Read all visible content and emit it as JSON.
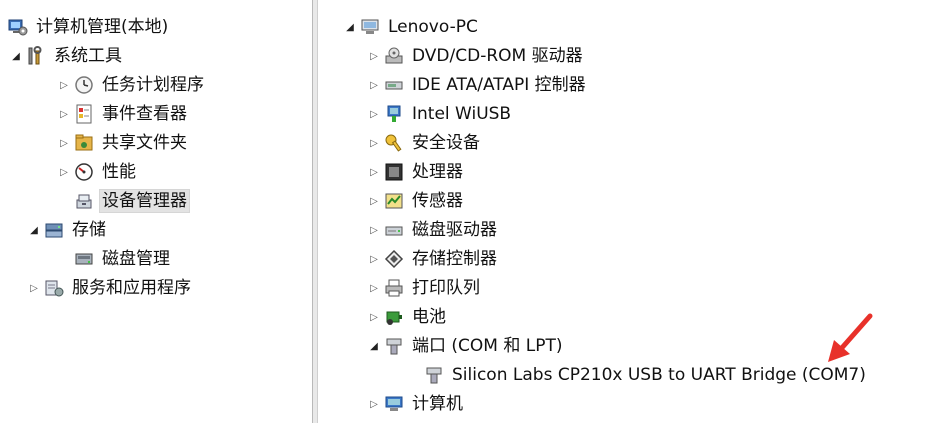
{
  "left_tree": {
    "root": {
      "label": "计算机管理(本地)",
      "icon": "computer-management-icon"
    },
    "system_tools": {
      "label": "系统工具",
      "icon": "tools-icon",
      "expander": "◢"
    },
    "task_scheduler": {
      "label": "任务计划程序",
      "icon": "clock-icon",
      "expander": "▷"
    },
    "event_viewer": {
      "label": "事件查看器",
      "icon": "event-viewer-icon",
      "expander": "▷"
    },
    "shared_folders": {
      "label": "共享文件夹",
      "icon": "shared-folder-icon",
      "expander": "▷"
    },
    "performance": {
      "label": "性能",
      "icon": "performance-icon",
      "expander": "▷"
    },
    "device_manager": {
      "label": "设备管理器",
      "icon": "device-manager-icon",
      "selected": true
    },
    "storage": {
      "label": "存储",
      "icon": "storage-icon",
      "expander": "◢"
    },
    "disk_management": {
      "label": "磁盘管理",
      "icon": "disk-management-icon"
    },
    "services_apps": {
      "label": "服务和应用程序",
      "icon": "services-icon",
      "expander": "▷"
    }
  },
  "right_tree": {
    "root": {
      "label": "Lenovo-PC",
      "icon": "computer-icon",
      "expander": "◢"
    },
    "items": [
      {
        "label": "DVD/CD-ROM 驱动器",
        "icon": "dvd-drive-icon",
        "expander": "▷"
      },
      {
        "label": "IDE ATA/ATAPI 控制器",
        "icon": "ide-controller-icon",
        "expander": "▷"
      },
      {
        "label": "Intel WiUSB",
        "icon": "usb-network-icon",
        "expander": "▷"
      },
      {
        "label": "安全设备",
        "icon": "security-key-icon",
        "expander": "▷"
      },
      {
        "label": "处理器",
        "icon": "processor-icon",
        "expander": "▷"
      },
      {
        "label": "传感器",
        "icon": "sensor-icon",
        "expander": "▷"
      },
      {
        "label": "磁盘驱动器",
        "icon": "disk-drive-icon",
        "expander": "▷"
      },
      {
        "label": "存储控制器",
        "icon": "storage-controller-icon",
        "expander": "▷"
      },
      {
        "label": "打印队列",
        "icon": "printer-icon",
        "expander": "▷"
      },
      {
        "label": "电池",
        "icon": "battery-icon",
        "expander": "▷"
      },
      {
        "label": "端口 (COM 和 LPT)",
        "icon": "port-icon",
        "expander": "◢"
      },
      {
        "label": "Silicon Labs CP210x USB to UART Bridge (COM7)",
        "icon": "port-icon"
      },
      {
        "label": "计算机",
        "icon": "computer-icon",
        "expander": "▷"
      }
    ]
  },
  "annotation": {
    "arrow_color": "#e8312a"
  }
}
